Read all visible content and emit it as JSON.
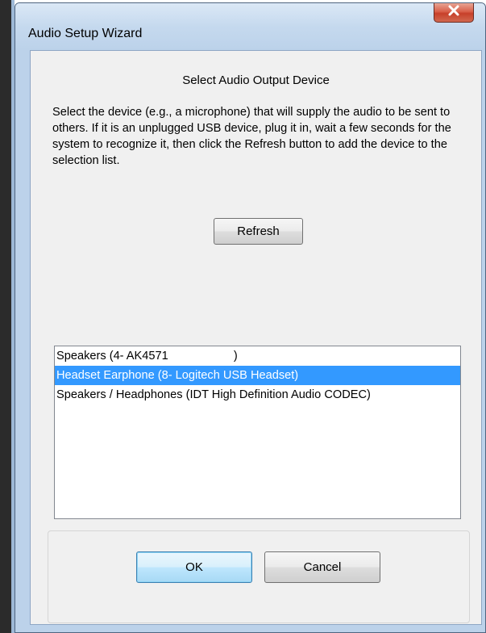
{
  "window": {
    "title": "Audio Setup Wizard",
    "close_glyph": "X"
  },
  "main": {
    "heading": "Select Audio Output Device",
    "description": "Select the device (e.g., a microphone) that will supply the audio to be sent to others.  If it is an unplugged USB device, plug it in, wait a few seconds for the system to recognize it, then click the Refresh button to add the device to the selection list.",
    "refresh_label": "Refresh"
  },
  "device_list": {
    "items": [
      "Speakers (4- AK4571                    )",
      "Headset Earphone (8- Logitech USB Headset)",
      "Speakers / Headphones (IDT High Definition Audio CODEC)"
    ],
    "selected_index": 1
  },
  "footer": {
    "ok_label": "OK",
    "cancel_label": "Cancel"
  },
  "colors": {
    "selection": "#3399ff",
    "client_background": "#f0f0f0",
    "frame": "#bcd2ea",
    "close_button": "#c7402a"
  },
  "icons": {
    "close": "close-icon"
  }
}
